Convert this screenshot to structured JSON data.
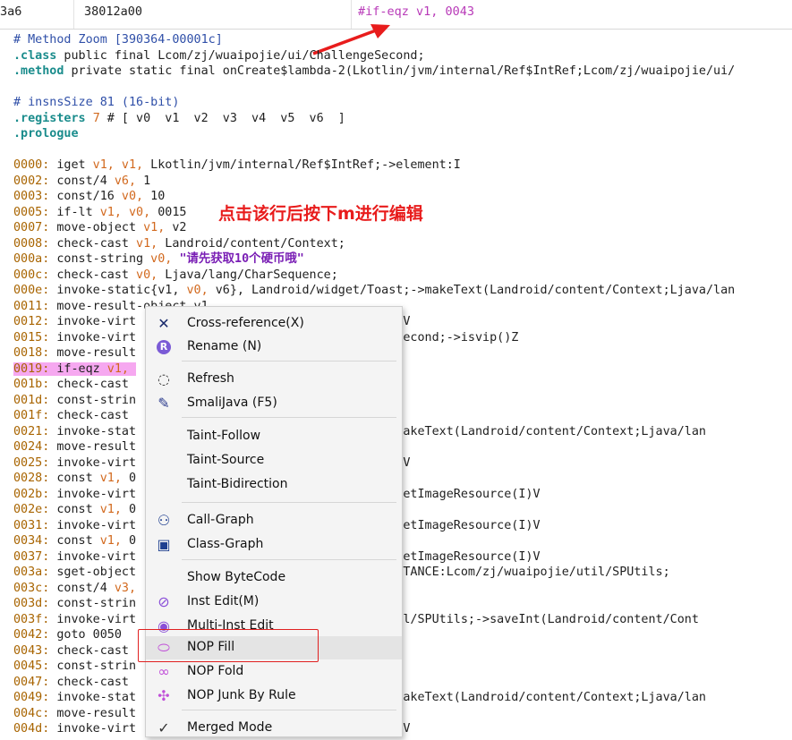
{
  "colors": {
    "accent_red": "#e81c1c",
    "highlight_pink": "#f6a8f0",
    "menu_bg": "#f4f4f4"
  },
  "topbar": {
    "col1": "3a6",
    "col2": "38012a00",
    "col3": "#if-eqz v1, 0043"
  },
  "annotation": "点击该行后按下m进行编辑",
  "code_lines": [
    "# Method Zoom [390364-00001c]",
    ".class public final Lcom/zj/wuaipojie/ui/ChallengeSecond;",
    ".method private static final onCreate$lambda-2(Lkotlin/jvm/internal/Ref$IntRef;Lcom/zj/wuaipojie/ui/",
    "",
    "# insnsSize 81 (16-bit)",
    ".registers 7 # [ v0  v1  v2  v3  v4  v5  v6  ]",
    ".prologue",
    "",
    "0000: iget v1, v1, Lkotlin/jvm/internal/Ref$IntRef;->element:I",
    "0002: const/4 v6, 1",
    "0003: const/16 v0, 10",
    "0005: if-lt v1, v0, 0015",
    "0007: move-object v1, v2",
    "0008: check-cast v1, Landroid/content/Context;",
    "000a: const-string v0, \"请先获取10个硬币哦\"",
    "000c: check-cast v0, Ljava/lang/CharSequence;",
    "000e: invoke-static{v1, v0, v6}, Landroid/widget/Toast;->makeText(Landroid/content/Context;Ljava/lan",
    "0011: move-result-object v1",
    "0012: invoke-virt                            ;->show()V",
    "0015: invoke-virt                            hallengeSecond;->isvip()Z",
    "0018: move-result",
    "0019: if-eqz v1, ",
    "001b: check-cast",
    "001d: const-strin",
    "001f: check-cast",
    "0021: invoke-stat                            Toast;->makeText(Landroid/content/Context;Ljava/lan",
    "0024: move-result",
    "0025: invoke-virt                            ;->show()V",
    "0028: const v1, 0",
    "002b: invoke-virt                            eView;->setImageResource(I)V",
    "002e: const v1, 0",
    "0031: invoke-virt                            eView;->setImageResource(I)V",
    "0034: const v1, 0",
    "0037: invoke-virt                            eView;->setImageResource(I)V",
    "003a: sget-object                            ils;->INSTANCE:Lcom/zj/wuaipojie/util/SPUtils;",
    "003c: const/4 v3,",
    "003d: const-strin",
    "003f: invoke-virt                            pojie/util/SPUtils;->saveInt(Landroid/content/Cont",
    "0042: goto 0050",
    "0043: check-cast",
    "0045: const-strin",
    "0047: check-cast",
    "0049: invoke-stat                            Toast;->makeText(Landroid/content/Context;Ljava/lan",
    "004c: move-result",
    "004d: invoke-virt                            ;->show()V"
  ],
  "menu": {
    "items": [
      {
        "label": "Cross-reference(X)",
        "icon": "cross-reference-icon"
      },
      {
        "label": "Rename (N)",
        "icon": "rename-icon"
      },
      {
        "label": "Refresh",
        "icon": "refresh-icon"
      },
      {
        "label": "SmaliJava (F5)",
        "icon": "smalijava-icon"
      },
      {
        "label": "Taint-Follow",
        "icon": ""
      },
      {
        "label": "Taint-Source",
        "icon": ""
      },
      {
        "label": "Taint-Bidirection",
        "icon": ""
      },
      {
        "label": "Call-Graph",
        "icon": "call-graph-icon"
      },
      {
        "label": "Class-Graph",
        "icon": "class-graph-icon"
      },
      {
        "label": "Show ByteCode",
        "icon": ""
      },
      {
        "label": "Inst Edit(M)",
        "icon": "inst-edit-icon"
      },
      {
        "label": "Multi-Inst Edit",
        "icon": "multi-inst-edit-icon"
      },
      {
        "label": "NOP Fill",
        "icon": "nop-fill-icon"
      },
      {
        "label": "NOP Fold",
        "icon": "nop-fold-icon"
      },
      {
        "label": "NOP Junk By Rule",
        "icon": "nop-junk-icon"
      },
      {
        "label": "Merged Mode",
        "icon": "check-icon"
      }
    ]
  }
}
